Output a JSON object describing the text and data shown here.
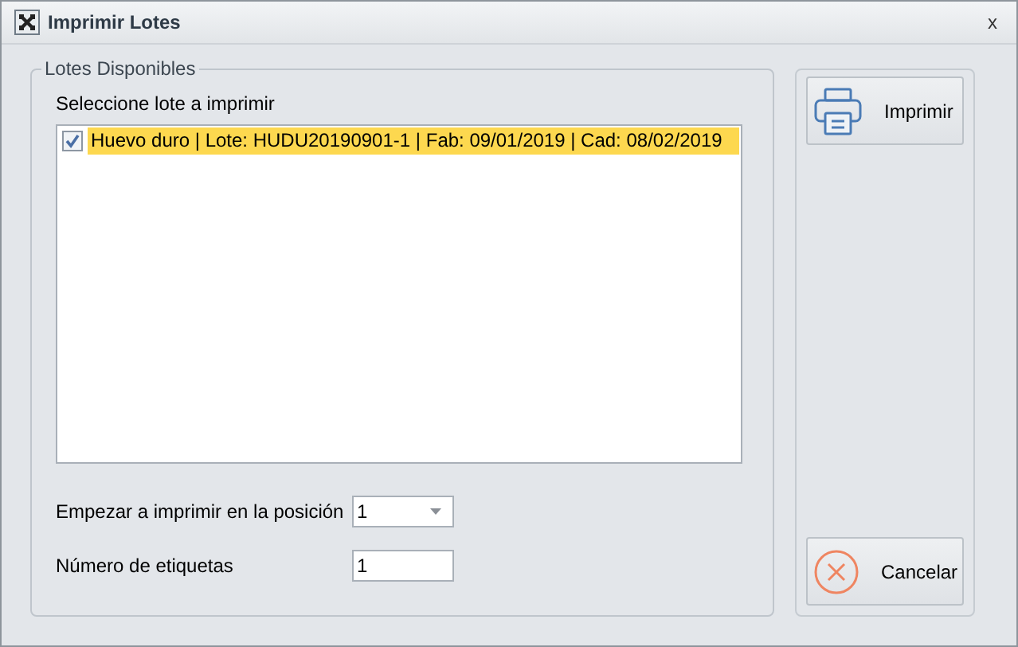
{
  "window": {
    "title": "Imprimir Lotes",
    "close": "x"
  },
  "group": {
    "title": "Lotes  Disponibles",
    "list_label": "Seleccione lote a imprimir",
    "items": [
      {
        "label": "Huevo duro | Lote: HUDU20190901-1 | Fab: 09/01/2019 | Cad: 08/02/2019",
        "checked": true,
        "selected": true
      }
    ],
    "fields": [
      {
        "kind": "dropdown",
        "label": "Empezar a imprimir en la posición",
        "value": "1"
      },
      {
        "kind": "text",
        "label": "Número de etiquetas",
        "value": "1"
      }
    ]
  },
  "buttons": [
    {
      "kind": "print",
      "label": "Imprimir"
    },
    {
      "kind": "cancel",
      "label": "Cancelar"
    }
  ]
}
